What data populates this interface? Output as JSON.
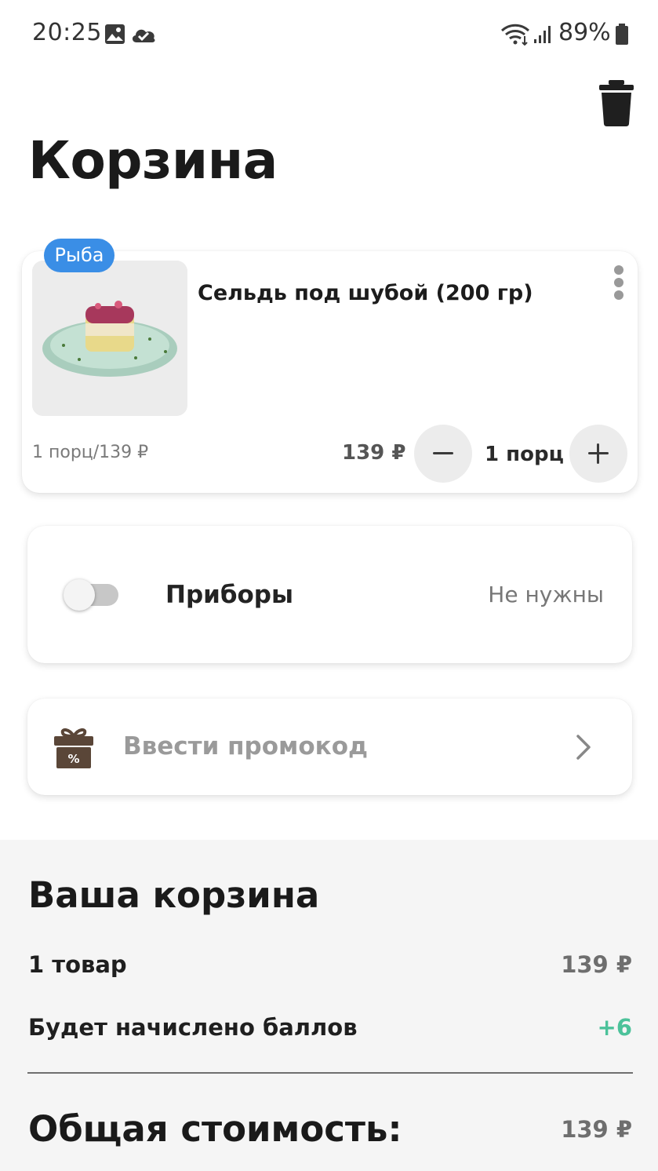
{
  "status_bar": {
    "time": "20:25",
    "battery": "89%",
    "icons": [
      "image-icon",
      "cloud-check-icon",
      "wifi-icon",
      "signal-icon",
      "battery-icon"
    ]
  },
  "header": {
    "title": "Корзина",
    "delete_icon": "trash-icon"
  },
  "cart_item": {
    "category": "Рыба",
    "name": "Сельдь под шубой (200 гр)",
    "unit_price": "1 порц/139 ₽",
    "price": "139 ₽",
    "quantity": "1 порц",
    "image_alt": "herring-salad-photo"
  },
  "cutlery": {
    "label": "Приборы",
    "value": "Не нужны",
    "toggle_on": false
  },
  "promo": {
    "label": "Ввести промокод",
    "icon": "gift-percent-icon"
  },
  "summary": {
    "title": "Ваша корзина",
    "items_label": "1 товар",
    "items_value": "139 ₽",
    "points_label": "Будет начислено баллов",
    "points_value": "+6",
    "total_label": "Общая стоимость:",
    "total_value": "139 ₽"
  },
  "colors": {
    "badge": "#3a8ee6",
    "points": "#4cc29a",
    "summary_bg": "#f5f5f5"
  }
}
